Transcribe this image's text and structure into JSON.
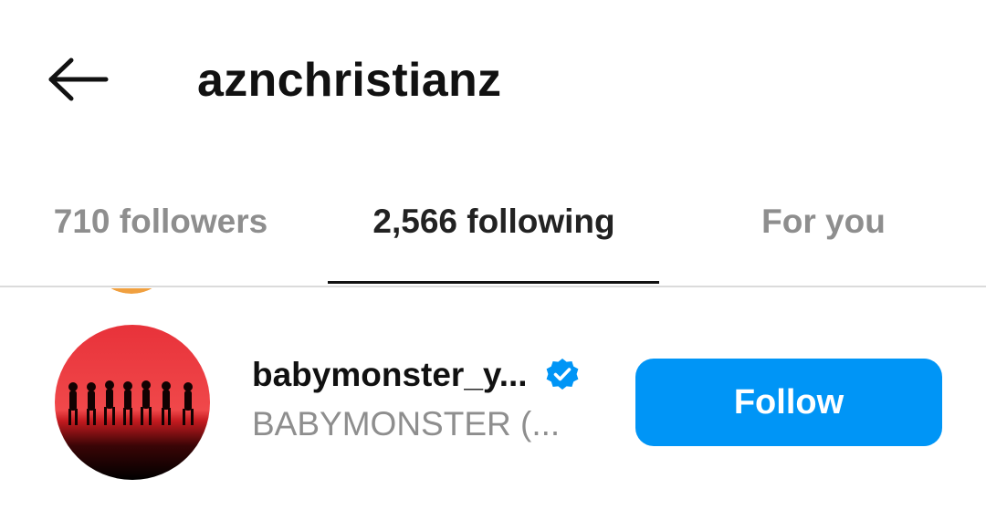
{
  "header": {
    "title": "aznchristianz",
    "back_icon": "arrow-left-icon"
  },
  "tabs": [
    {
      "label": "710 followers",
      "active": false
    },
    {
      "label": "2,566 following",
      "active": true
    },
    {
      "label": "For you",
      "active": false
    }
  ],
  "users": [
    {
      "username": "babymonster_y...",
      "full_name": "BABYMONSTER (...",
      "verified": true,
      "verified_icon": "verified-badge-icon",
      "follow_label": "Follow"
    }
  ],
  "colors": {
    "accent": "#0095f6",
    "muted_text": "#8e8e8e",
    "divider": "#dbdbdb",
    "peek_avatar": "#f0a040"
  }
}
